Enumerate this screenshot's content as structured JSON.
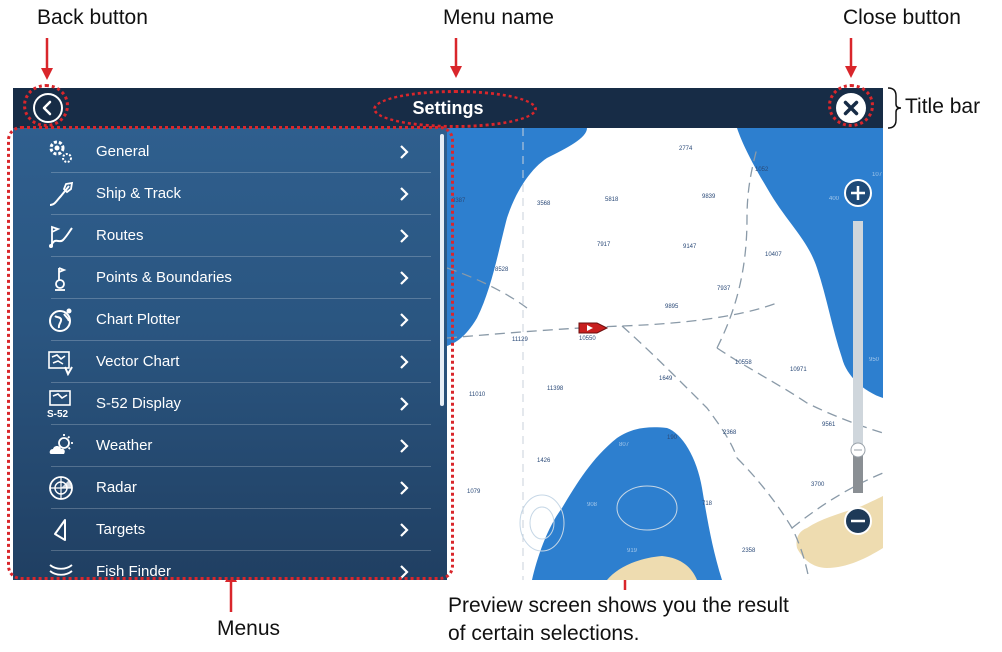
{
  "annotations": {
    "back_button": "Back button",
    "menu_name": "Menu name",
    "close_button": "Close button",
    "title_bar": "Title bar",
    "menus": "Menus",
    "preview_line1": "Preview screen shows you the result",
    "preview_line2": "of certain selections."
  },
  "titlebar": {
    "title": "Settings",
    "back_icon": "chevron-left-icon",
    "close_icon": "close-icon"
  },
  "menu": {
    "items": [
      {
        "label": "General",
        "icon": "gears-icon"
      },
      {
        "label": "Ship & Track",
        "icon": "ship-track-icon"
      },
      {
        "label": "Routes",
        "icon": "routes-icon"
      },
      {
        "label": "Points & Boundaries",
        "icon": "waypoint-icon"
      },
      {
        "label": "Chart Plotter",
        "icon": "globe-icon"
      },
      {
        "label": "Vector Chart",
        "icon": "vector-chart-icon"
      },
      {
        "label": "S-52 Display",
        "icon": "s52-chart-icon",
        "icon_text": "S-52"
      },
      {
        "label": "Weather",
        "icon": "weather-icon"
      },
      {
        "label": "Radar",
        "icon": "radar-icon"
      },
      {
        "label": "Targets",
        "icon": "target-icon"
      },
      {
        "label": "Fish Finder",
        "icon": "fish-finder-icon"
      }
    ]
  },
  "map": {
    "depths": [
      "2774",
      "1052",
      "5818",
      "9839",
      "3568",
      "8387",
      "7917",
      "9147",
      "10407",
      "8528",
      "7937",
      "9895",
      "11129",
      "10550",
      "10558",
      "10971",
      "1649",
      "11010",
      "11398",
      "9561",
      "190",
      "2368",
      "1426",
      "807",
      "1079",
      "908",
      "718",
      "3700",
      "2358",
      "107",
      "400",
      "950",
      "919",
      "989"
    ],
    "zoom_in_icon": "zoom-in-icon",
    "zoom_out_icon": "zoom-out-icon"
  },
  "colors": {
    "title_bar": "#172c46",
    "menu_top": "#2f5f8e",
    "menu_bottom": "#203f62",
    "sea_deep": "#2d7fcf",
    "land": "#eedcb0",
    "annotation_red": "#d9262b",
    "vessel": "#c81e1e"
  }
}
